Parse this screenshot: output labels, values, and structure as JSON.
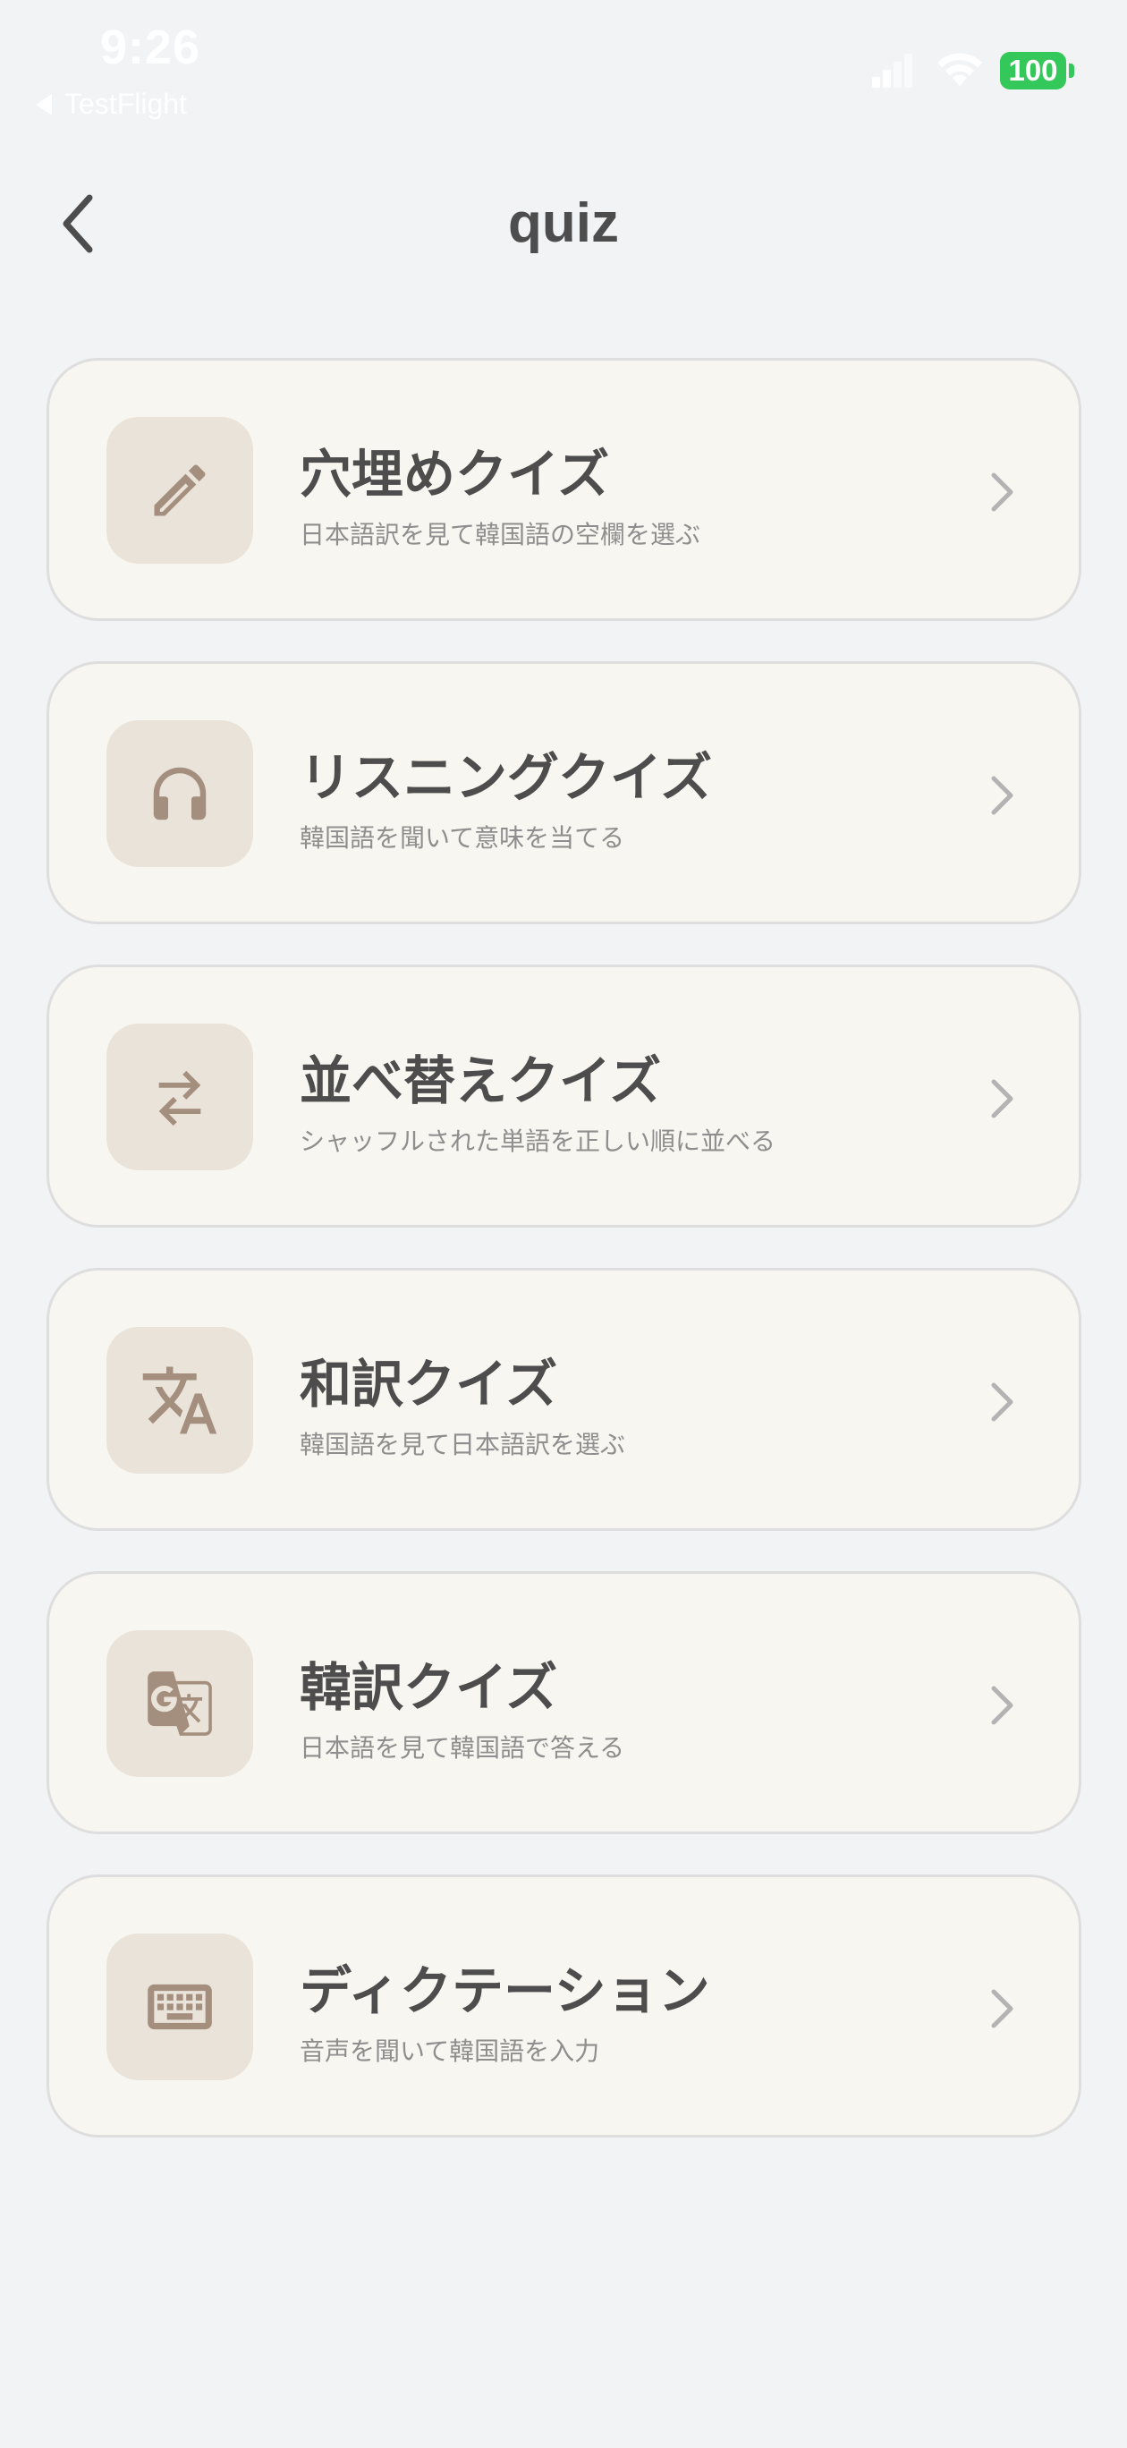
{
  "status_bar": {
    "time": "9:26",
    "back_app": "TestFlight",
    "battery": "100"
  },
  "header": {
    "title": "quiz",
    "back_icon": "chevron-left-icon"
  },
  "quiz_items": [
    {
      "title": "穴埋めクイズ",
      "subtitle": "日本語訳を見て韓国語の空欄を選ぶ",
      "icon": "pencil-icon"
    },
    {
      "title": "リスニングクイズ",
      "subtitle": "韓国語を聞いて意味を当てる",
      "icon": "headphones-icon"
    },
    {
      "title": "並べ替えクイズ",
      "subtitle": "シャッフルされた単語を正しい順に並べる",
      "icon": "swap-arrows-icon"
    },
    {
      "title": "和訳クイズ",
      "subtitle": "韓国語を見て日本語訳を選ぶ",
      "icon": "translate-icon"
    },
    {
      "title": "韓訳クイズ",
      "subtitle": "日本語を見て韓国語で答える",
      "icon": "g-translate-icon"
    },
    {
      "title": "ディクテーション",
      "subtitle": "音声を聞いて韓国語を入力",
      "icon": "keyboard-icon"
    }
  ],
  "colors": {
    "background": "#F2F3F5",
    "card": "#F8F6F0",
    "icon_box": "#EAE3DA",
    "icon": "#A48F7E",
    "battery": "#34C759"
  }
}
